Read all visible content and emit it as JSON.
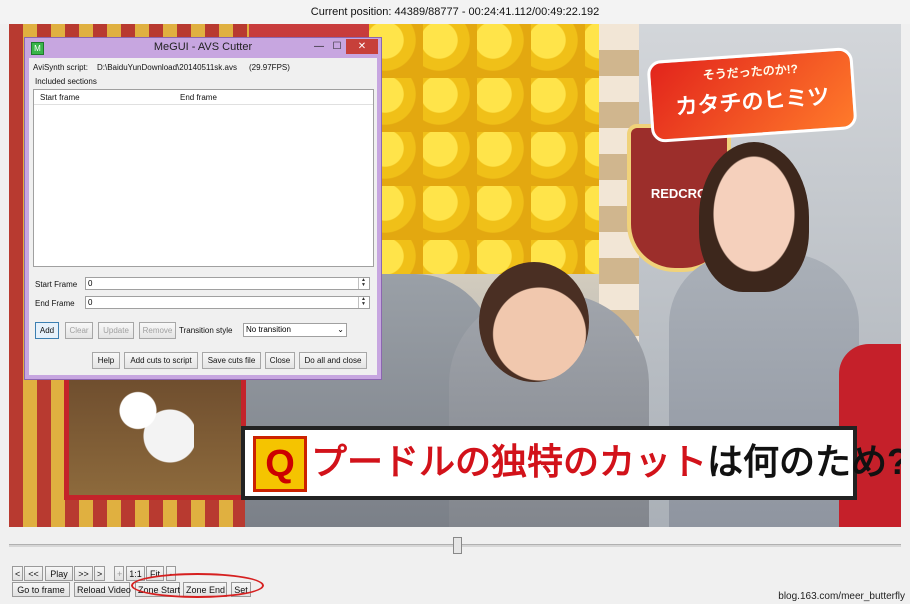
{
  "status": {
    "text": "Current position: 44389/88777   -   00:24:41.112/00:49:22.192"
  },
  "video": {
    "show_logo_line1": "そうだったのか!?",
    "show_logo_line2": "カタチのヒミツ",
    "shield_text": "REDCRO",
    "question_mark": "Q",
    "question_red": "プードルの独特のカット",
    "question_black": "は何のため?"
  },
  "player_controls": {
    "nav": [
      "<",
      "<<",
      "Play",
      ">>",
      ">"
    ],
    "zoom_plus": "+",
    "zoom_1to1": "1:1",
    "fit": "Fit",
    "zoom_minus": "-",
    "go_to_frame": "Go to frame",
    "reload_video": "Reload Video",
    "zone_start": "Zone Start",
    "zone_end": "Zone End",
    "set": "Set"
  },
  "watermark": "blog.163.com/meer_butterfly",
  "dialog": {
    "title": "MeGUI - AVS Cutter",
    "icon_text": "M",
    "minimize": "—",
    "maximize": "☐",
    "close": "✕",
    "script_label": "AviSynth script:",
    "script_path": "D:\\BaiduYunDownload\\20140511sk.avs",
    "fps": "(29.97FPS)",
    "included_sections": "Included sections",
    "col_start": "Start frame",
    "col_end": "End frame",
    "start_frame_label": "Start Frame",
    "start_frame_value": "0",
    "end_frame_label": "End Frame",
    "end_frame_value": "0",
    "add": "Add",
    "clear": "Clear",
    "update": "Update",
    "remove": "Remove",
    "transition_label": "Transition style",
    "transition_value": "No transition",
    "help": "Help",
    "add_cuts": "Add cuts to script",
    "save_cuts": "Save cuts file",
    "close_btn": "Close",
    "do_all": "Do all and close"
  }
}
